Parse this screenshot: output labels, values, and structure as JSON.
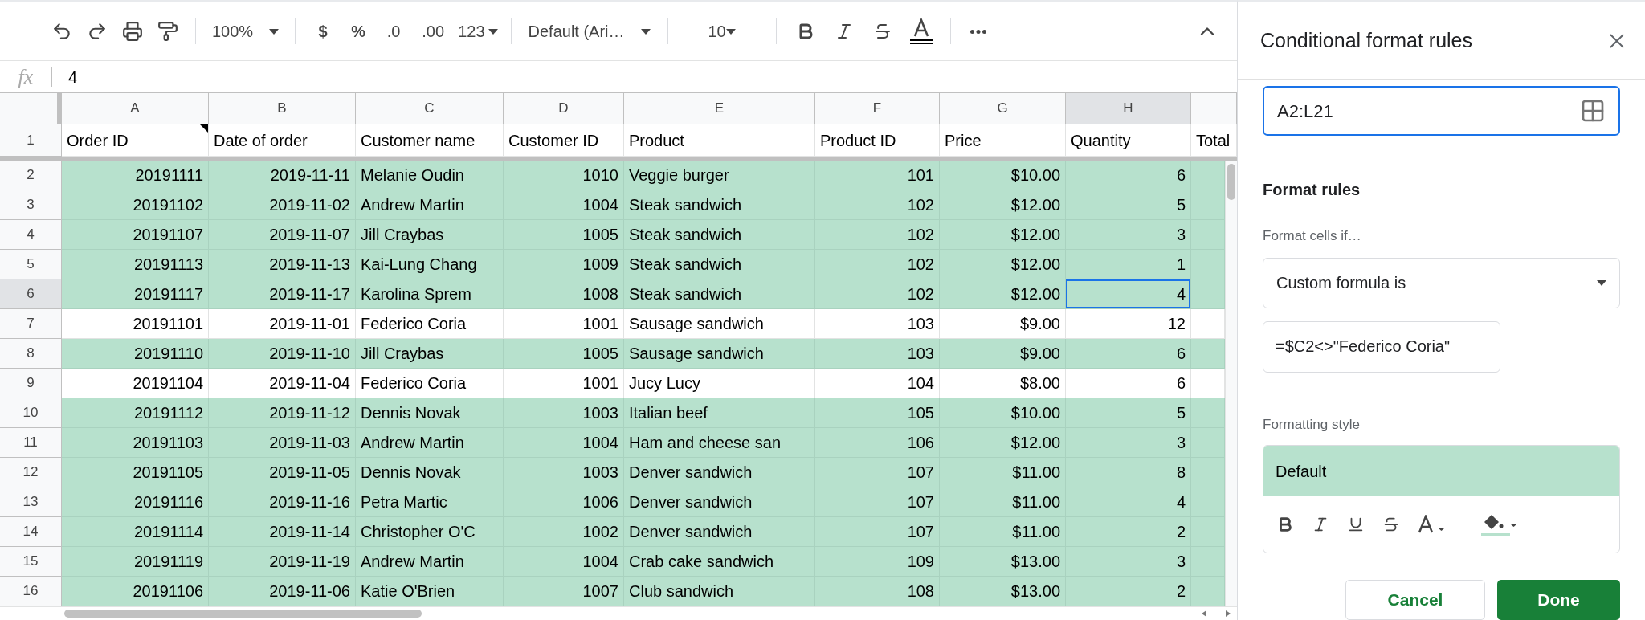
{
  "toolbar": {
    "zoom": "100%",
    "currency": "$",
    "percent": "%",
    "decrease_decimals": ".0",
    "increase_decimals": ".00",
    "number_format": "123",
    "font": "Default (Ari…",
    "font_size": "10"
  },
  "formula_bar": {
    "label": "fx",
    "value": "4"
  },
  "columns": [
    {
      "letter": "A",
      "heading": "Order ID",
      "kind": "number",
      "note": true,
      "selected": false
    },
    {
      "letter": "B",
      "heading": "Date of order",
      "kind": "number",
      "selected": false
    },
    {
      "letter": "C",
      "heading": "Customer name",
      "kind": "text",
      "selected": false
    },
    {
      "letter": "D",
      "heading": "Customer ID",
      "kind": "number",
      "selected": false
    },
    {
      "letter": "E",
      "heading": "Product",
      "kind": "text",
      "selected": false
    },
    {
      "letter": "F",
      "heading": "Product ID",
      "kind": "number",
      "selected": false
    },
    {
      "letter": "G",
      "heading": "Price",
      "kind": "number",
      "selected": false
    },
    {
      "letter": "H",
      "heading": "Quantity",
      "kind": "number",
      "selected": true
    },
    {
      "heading": "Total",
      "kind": "number",
      "selected": false
    }
  ],
  "rows": [
    {
      "number": "2",
      "highlighted": true,
      "selected": false,
      "cells": [
        "20191111",
        "2019-11-11",
        "Melanie Oudin",
        "1010",
        "Veggie burger",
        "101",
        "$10.00",
        "6"
      ]
    },
    {
      "number": "3",
      "highlighted": true,
      "selected": false,
      "cells": [
        "20191102",
        "2019-11-02",
        "Andrew Martin",
        "1004",
        "Steak sandwich",
        "102",
        "$12.00",
        "5"
      ]
    },
    {
      "number": "4",
      "highlighted": true,
      "selected": false,
      "cells": [
        "20191107",
        "2019-11-07",
        "Jill Craybas",
        "1005",
        "Steak sandwich",
        "102",
        "$12.00",
        "3"
      ]
    },
    {
      "number": "5",
      "highlighted": true,
      "selected": false,
      "cells": [
        "20191113",
        "2019-11-13",
        "Kai-Lung Chang",
        "1009",
        "Steak sandwich",
        "102",
        "$12.00",
        "1"
      ]
    },
    {
      "number": "6",
      "highlighted": true,
      "selected": true,
      "cells": [
        "20191117",
        "2019-11-17",
        "Karolina Sprem",
        "1008",
        "Steak sandwich",
        "102",
        "$12.00",
        "4"
      ]
    },
    {
      "number": "7",
      "highlighted": false,
      "selected": false,
      "cells": [
        "20191101",
        "2019-11-01",
        "Federico Coria",
        "1001",
        "Sausage sandwich",
        "103",
        "$9.00",
        "12"
      ]
    },
    {
      "number": "8",
      "highlighted": true,
      "selected": false,
      "cells": [
        "20191110",
        "2019-11-10",
        "Jill Craybas",
        "1005",
        "Sausage sandwich",
        "103",
        "$9.00",
        "6"
      ]
    },
    {
      "number": "9",
      "highlighted": false,
      "selected": false,
      "cells": [
        "20191104",
        "2019-11-04",
        "Federico Coria",
        "1001",
        "Jucy Lucy",
        "104",
        "$8.00",
        "6"
      ]
    },
    {
      "number": "10",
      "highlighted": true,
      "selected": false,
      "cells": [
        "20191112",
        "2019-11-12",
        "Dennis Novak",
        "1003",
        "Italian beef",
        "105",
        "$10.00",
        "5"
      ]
    },
    {
      "number": "11",
      "highlighted": true,
      "selected": false,
      "cells": [
        "20191103",
        "2019-11-03",
        "Andrew Martin",
        "1004",
        "Ham and cheese san",
        "106",
        "$12.00",
        "3"
      ]
    },
    {
      "number": "12",
      "highlighted": true,
      "selected": false,
      "cells": [
        "20191105",
        "2019-11-05",
        "Dennis Novak",
        "1003",
        "Denver sandwich",
        "107",
        "$11.00",
        "8"
      ]
    },
    {
      "number": "13",
      "highlighted": true,
      "selected": false,
      "cells": [
        "20191116",
        "2019-11-16",
        "Petra Martic",
        "1006",
        "Denver sandwich",
        "107",
        "$11.00",
        "4"
      ]
    },
    {
      "number": "14",
      "highlighted": true,
      "selected": false,
      "cells": [
        "20191114",
        "2019-11-14",
        "Christopher O'C",
        "1002",
        "Denver sandwich",
        "107",
        "$11.00",
        "2"
      ]
    },
    {
      "number": "15",
      "highlighted": true,
      "selected": false,
      "cells": [
        "20191119",
        "2019-11-19",
        "Andrew Martin",
        "1004",
        "Crab cake sandwich",
        "109",
        "$13.00",
        "3"
      ]
    },
    {
      "number": "16",
      "highlighted": true,
      "selected": false,
      "cells": [
        "20191106",
        "2019-11-06",
        "Katie O'Brien",
        "1007",
        "Club sandwich",
        "108",
        "$13.00",
        "2"
      ]
    }
  ],
  "header_row_number": "1",
  "panel": {
    "title": "Conditional format rules",
    "range": "A2:L21",
    "section": "Format rules",
    "condition_label": "Format cells if…",
    "condition": "Custom formula is",
    "formula": "=$C2<>\"Federico Coria\"",
    "style_label": "Formatting style",
    "style_preview": "Default",
    "buttons": [
      {
        "label": "Cancel",
        "kind": "secondary"
      },
      {
        "label": "Done",
        "kind": "primary"
      }
    ]
  }
}
